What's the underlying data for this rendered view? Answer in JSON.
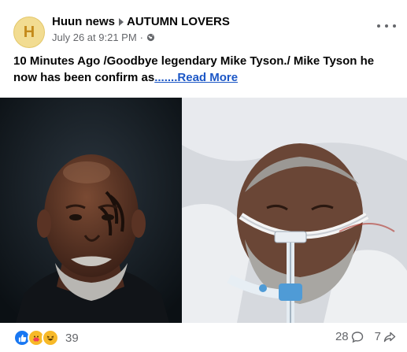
{
  "post": {
    "avatar_letter": "H",
    "author": "Huun news",
    "group": "AUTUMN LOVERS",
    "timestamp": "July 26 at 9:21 PM",
    "separator": "·",
    "privacy_icon": "globe-icon",
    "text": "10 Minutes Ago /Goodbye legendary Mike Tyson./ Mike Tyson he now has been confirm as",
    "read_more": ".......Read More"
  },
  "reactions": {
    "icons": [
      "like-icon",
      "care-icon",
      "haha-icon"
    ],
    "count": "39"
  },
  "stats": {
    "comments": "28",
    "shares": "7"
  },
  "colors": {
    "link": "#1c57c6",
    "secondary_text": "#65676b",
    "avatar_bg": "#f2dc91",
    "like_blue": "#1877f2",
    "reaction_yellow": "#f7b928"
  }
}
